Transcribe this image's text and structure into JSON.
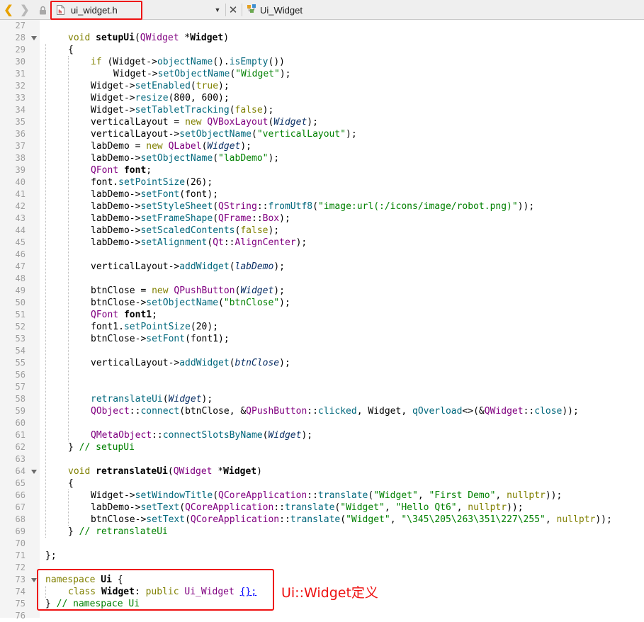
{
  "toolbar": {
    "back_icon": "chevron-left-icon",
    "forward_icon": "chevron-right-icon",
    "lock_icon": "lock-icon",
    "file_icon": "header-file-icon",
    "file_tab_label": "ui_widget.h",
    "dropdown_icon": "dropdown-arrow-icon",
    "close_icon": "close-icon",
    "class_icon": "class-icon",
    "class_selector_label": "Ui_Widget"
  },
  "editor": {
    "lines": [
      {
        "n": "27",
        "fold": false,
        "indent": 0,
        "tokens": []
      },
      {
        "n": "28",
        "fold": true,
        "indent": 1,
        "tokens": [
          [
            "kw",
            "void "
          ],
          [
            "fnb",
            "setupUi"
          ],
          [
            "p",
            "("
          ],
          [
            "type",
            "QWidget"
          ],
          [
            "p",
            " *"
          ],
          [
            "b",
            "Widget"
          ],
          [
            "p",
            ")"
          ]
        ]
      },
      {
        "n": "29",
        "fold": false,
        "indent": 1,
        "tokens": [
          [
            "p",
            "{"
          ]
        ]
      },
      {
        "n": "30",
        "fold": false,
        "indent": 2,
        "tokens": [
          [
            "kw",
            "if"
          ],
          [
            "p",
            " (Widget->"
          ],
          [
            "fn",
            "objectName"
          ],
          [
            "p",
            "()."
          ],
          [
            "fn",
            "isEmpty"
          ],
          [
            "p",
            "())"
          ]
        ]
      },
      {
        "n": "31",
        "fold": false,
        "indent": 3,
        "tokens": [
          [
            "p",
            "Widget->"
          ],
          [
            "fn",
            "setObjectName"
          ],
          [
            "p",
            "("
          ],
          [
            "str",
            "\"Widget\""
          ],
          [
            "p",
            ");"
          ]
        ]
      },
      {
        "n": "32",
        "fold": false,
        "indent": 2,
        "tokens": [
          [
            "p",
            "Widget->"
          ],
          [
            "fn",
            "setEnabled"
          ],
          [
            "p",
            "("
          ],
          [
            "kw",
            "true"
          ],
          [
            "p",
            ");"
          ]
        ]
      },
      {
        "n": "33",
        "fold": false,
        "indent": 2,
        "tokens": [
          [
            "p",
            "Widget->"
          ],
          [
            "fn",
            "resize"
          ],
          [
            "p",
            "(800, 600);"
          ]
        ]
      },
      {
        "n": "34",
        "fold": false,
        "indent": 2,
        "tokens": [
          [
            "p",
            "Widget->"
          ],
          [
            "fn",
            "setTabletTracking"
          ],
          [
            "p",
            "("
          ],
          [
            "kw",
            "false"
          ],
          [
            "p",
            ");"
          ]
        ]
      },
      {
        "n": "35",
        "fold": false,
        "indent": 2,
        "tokens": [
          [
            "p",
            "verticalLayout = "
          ],
          [
            "kw",
            "new "
          ],
          [
            "type",
            "QVBoxLayout"
          ],
          [
            "p",
            "("
          ],
          [
            "it",
            "Widget"
          ],
          [
            "p",
            ");"
          ]
        ]
      },
      {
        "n": "36",
        "fold": false,
        "indent": 2,
        "tokens": [
          [
            "p",
            "verticalLayout->"
          ],
          [
            "fn",
            "setObjectName"
          ],
          [
            "p",
            "("
          ],
          [
            "str",
            "\"verticalLayout\""
          ],
          [
            "p",
            ");"
          ]
        ]
      },
      {
        "n": "37",
        "fold": false,
        "indent": 2,
        "tokens": [
          [
            "p",
            "labDemo = "
          ],
          [
            "kw",
            "new "
          ],
          [
            "type",
            "QLabel"
          ],
          [
            "p",
            "("
          ],
          [
            "it",
            "Widget"
          ],
          [
            "p",
            ");"
          ]
        ]
      },
      {
        "n": "38",
        "fold": false,
        "indent": 2,
        "tokens": [
          [
            "p",
            "labDemo->"
          ],
          [
            "fn",
            "setObjectName"
          ],
          [
            "p",
            "("
          ],
          [
            "str",
            "\"labDemo\""
          ],
          [
            "p",
            ");"
          ]
        ]
      },
      {
        "n": "39",
        "fold": false,
        "indent": 2,
        "tokens": [
          [
            "type",
            "QFont "
          ],
          [
            "b",
            "font"
          ],
          [
            "p",
            ";"
          ]
        ]
      },
      {
        "n": "40",
        "fold": false,
        "indent": 2,
        "tokens": [
          [
            "p",
            "font."
          ],
          [
            "fn",
            "setPointSize"
          ],
          [
            "p",
            "(26);"
          ]
        ]
      },
      {
        "n": "41",
        "fold": false,
        "indent": 2,
        "tokens": [
          [
            "p",
            "labDemo->"
          ],
          [
            "fn",
            "setFont"
          ],
          [
            "p",
            "(font);"
          ]
        ]
      },
      {
        "n": "42",
        "fold": false,
        "indent": 2,
        "tokens": [
          [
            "p",
            "labDemo->"
          ],
          [
            "fn",
            "setStyleSheet"
          ],
          [
            "p",
            "("
          ],
          [
            "type",
            "QString"
          ],
          [
            "p",
            "::"
          ],
          [
            "fn",
            "fromUtf8"
          ],
          [
            "p",
            "("
          ],
          [
            "str",
            "\"image:url(:/icons/image/robot.png)\""
          ],
          [
            "p",
            "));"
          ]
        ]
      },
      {
        "n": "43",
        "fold": false,
        "indent": 2,
        "tokens": [
          [
            "p",
            "labDemo->"
          ],
          [
            "fn",
            "setFrameShape"
          ],
          [
            "p",
            "("
          ],
          [
            "type",
            "QFrame"
          ],
          [
            "p",
            "::"
          ],
          [
            "type",
            "Box"
          ],
          [
            "p",
            ");"
          ]
        ]
      },
      {
        "n": "44",
        "fold": false,
        "indent": 2,
        "tokens": [
          [
            "p",
            "labDemo->"
          ],
          [
            "fn",
            "setScaledContents"
          ],
          [
            "p",
            "("
          ],
          [
            "kw",
            "false"
          ],
          [
            "p",
            ");"
          ]
        ]
      },
      {
        "n": "45",
        "fold": false,
        "indent": 2,
        "tokens": [
          [
            "p",
            "labDemo->"
          ],
          [
            "fn",
            "setAlignment"
          ],
          [
            "p",
            "("
          ],
          [
            "type",
            "Qt"
          ],
          [
            "p",
            "::"
          ],
          [
            "type",
            "AlignCenter"
          ],
          [
            "p",
            ");"
          ]
        ]
      },
      {
        "n": "46",
        "fold": false,
        "indent": 2,
        "tokens": []
      },
      {
        "n": "47",
        "fold": false,
        "indent": 2,
        "tokens": [
          [
            "p",
            "verticalLayout->"
          ],
          [
            "fn",
            "addWidget"
          ],
          [
            "p",
            "("
          ],
          [
            "it",
            "labDemo"
          ],
          [
            "p",
            ");"
          ]
        ]
      },
      {
        "n": "48",
        "fold": false,
        "indent": 2,
        "tokens": []
      },
      {
        "n": "49",
        "fold": false,
        "indent": 2,
        "tokens": [
          [
            "p",
            "btnClose = "
          ],
          [
            "kw",
            "new "
          ],
          [
            "type",
            "QPushButton"
          ],
          [
            "p",
            "("
          ],
          [
            "it",
            "Widget"
          ],
          [
            "p",
            ");"
          ]
        ]
      },
      {
        "n": "50",
        "fold": false,
        "indent": 2,
        "tokens": [
          [
            "p",
            "btnClose->"
          ],
          [
            "fn",
            "setObjectName"
          ],
          [
            "p",
            "("
          ],
          [
            "str",
            "\"btnClose\""
          ],
          [
            "p",
            ");"
          ]
        ]
      },
      {
        "n": "51",
        "fold": false,
        "indent": 2,
        "tokens": [
          [
            "type",
            "QFont "
          ],
          [
            "b",
            "font1"
          ],
          [
            "p",
            ";"
          ]
        ]
      },
      {
        "n": "52",
        "fold": false,
        "indent": 2,
        "tokens": [
          [
            "p",
            "font1."
          ],
          [
            "fn",
            "setPointSize"
          ],
          [
            "p",
            "(20);"
          ]
        ]
      },
      {
        "n": "53",
        "fold": false,
        "indent": 2,
        "tokens": [
          [
            "p",
            "btnClose->"
          ],
          [
            "fn",
            "setFont"
          ],
          [
            "p",
            "(font1);"
          ]
        ]
      },
      {
        "n": "54",
        "fold": false,
        "indent": 2,
        "tokens": []
      },
      {
        "n": "55",
        "fold": false,
        "indent": 2,
        "tokens": [
          [
            "p",
            "verticalLayout->"
          ],
          [
            "fn",
            "addWidget"
          ],
          [
            "p",
            "("
          ],
          [
            "it",
            "btnClose"
          ],
          [
            "p",
            ");"
          ]
        ]
      },
      {
        "n": "56",
        "fold": false,
        "indent": 2,
        "tokens": []
      },
      {
        "n": "57",
        "fold": false,
        "indent": 2,
        "tokens": []
      },
      {
        "n": "58",
        "fold": false,
        "indent": 2,
        "tokens": [
          [
            "fn",
            "retranslateUi"
          ],
          [
            "p",
            "("
          ],
          [
            "it",
            "Widget"
          ],
          [
            "p",
            ");"
          ]
        ]
      },
      {
        "n": "59",
        "fold": false,
        "indent": 2,
        "tokens": [
          [
            "type",
            "QObject"
          ],
          [
            "p",
            "::"
          ],
          [
            "fn",
            "connect"
          ],
          [
            "p",
            "(btnClose, &"
          ],
          [
            "type",
            "QPushButton"
          ],
          [
            "p",
            "::"
          ],
          [
            "fn",
            "clicked"
          ],
          [
            "p",
            ", Widget, "
          ],
          [
            "fn",
            "qOverload"
          ],
          [
            "p",
            "<>(&"
          ],
          [
            "type",
            "QWidget"
          ],
          [
            "p",
            "::"
          ],
          [
            "fn",
            "close"
          ],
          [
            "p",
            "));"
          ]
        ]
      },
      {
        "n": "60",
        "fold": false,
        "indent": 2,
        "tokens": []
      },
      {
        "n": "61",
        "fold": false,
        "indent": 2,
        "tokens": [
          [
            "type",
            "QMetaObject"
          ],
          [
            "p",
            "::"
          ],
          [
            "fn",
            "connectSlotsByName"
          ],
          [
            "p",
            "("
          ],
          [
            "it",
            "Widget"
          ],
          [
            "p",
            ");"
          ]
        ]
      },
      {
        "n": "62",
        "fold": false,
        "indent": 1,
        "tokens": [
          [
            "p",
            "} "
          ],
          [
            "cmt",
            "// setupUi"
          ]
        ]
      },
      {
        "n": "63",
        "fold": false,
        "indent": 1,
        "tokens": []
      },
      {
        "n": "64",
        "fold": true,
        "indent": 1,
        "tokens": [
          [
            "kw",
            "void "
          ],
          [
            "fnb",
            "retranslateUi"
          ],
          [
            "p",
            "("
          ],
          [
            "type",
            "QWidget"
          ],
          [
            "p",
            " *"
          ],
          [
            "b",
            "Widget"
          ],
          [
            "p",
            ")"
          ]
        ]
      },
      {
        "n": "65",
        "fold": false,
        "indent": 1,
        "tokens": [
          [
            "p",
            "{"
          ]
        ]
      },
      {
        "n": "66",
        "fold": false,
        "indent": 2,
        "tokens": [
          [
            "p",
            "Widget->"
          ],
          [
            "fn",
            "setWindowTitle"
          ],
          [
            "p",
            "("
          ],
          [
            "type",
            "QCoreApplication"
          ],
          [
            "p",
            "::"
          ],
          [
            "fn",
            "translate"
          ],
          [
            "p",
            "("
          ],
          [
            "str",
            "\"Widget\""
          ],
          [
            "p",
            ", "
          ],
          [
            "str",
            "\"First Demo\""
          ],
          [
            "p",
            ", "
          ],
          [
            "kw",
            "nullptr"
          ],
          [
            "p",
            "));"
          ]
        ]
      },
      {
        "n": "67",
        "fold": false,
        "indent": 2,
        "tokens": [
          [
            "p",
            "labDemo->"
          ],
          [
            "fn",
            "setText"
          ],
          [
            "p",
            "("
          ],
          [
            "type",
            "QCoreApplication"
          ],
          [
            "p",
            "::"
          ],
          [
            "fn",
            "translate"
          ],
          [
            "p",
            "("
          ],
          [
            "str",
            "\"Widget\""
          ],
          [
            "p",
            ", "
          ],
          [
            "str",
            "\"Hello Qt6\""
          ],
          [
            "p",
            ", "
          ],
          [
            "kw",
            "nullptr"
          ],
          [
            "p",
            "));"
          ]
        ]
      },
      {
        "n": "68",
        "fold": false,
        "indent": 2,
        "tokens": [
          [
            "p",
            "btnClose->"
          ],
          [
            "fn",
            "setText"
          ],
          [
            "p",
            "("
          ],
          [
            "type",
            "QCoreApplication"
          ],
          [
            "p",
            "::"
          ],
          [
            "fn",
            "translate"
          ],
          [
            "p",
            "("
          ],
          [
            "str",
            "\"Widget\""
          ],
          [
            "p",
            ", "
          ],
          [
            "str",
            "\"\\345\\205\\263\\351\\227\\255\""
          ],
          [
            "p",
            ", "
          ],
          [
            "kw",
            "nullptr"
          ],
          [
            "p",
            "));"
          ]
        ]
      },
      {
        "n": "69",
        "fold": false,
        "indent": 1,
        "tokens": [
          [
            "p",
            "} "
          ],
          [
            "cmt",
            "// retranslateUi"
          ]
        ]
      },
      {
        "n": "70",
        "fold": false,
        "indent": 1,
        "tokens": []
      },
      {
        "n": "71",
        "fold": false,
        "indent": 0,
        "tokens": [
          [
            "p",
            "};"
          ]
        ]
      },
      {
        "n": "72",
        "fold": false,
        "indent": 0,
        "tokens": []
      },
      {
        "n": "73",
        "fold": true,
        "indent": 0,
        "tokens": [
          [
            "kw",
            "namespace "
          ],
          [
            "b",
            "Ui"
          ],
          [
            "p",
            " {"
          ]
        ]
      },
      {
        "n": "74",
        "fold": false,
        "indent": 1,
        "tokens": [
          [
            "kw",
            "class "
          ],
          [
            "b",
            "Widget"
          ],
          [
            "p",
            ": "
          ],
          [
            "kw",
            "public "
          ],
          [
            "type",
            "Ui_Widget"
          ],
          [
            "p",
            " "
          ],
          [
            "link",
            "{};"
          ]
        ]
      },
      {
        "n": "75",
        "fold": false,
        "indent": 0,
        "tokens": [
          [
            "p",
            "} "
          ],
          [
            "cmt",
            "// namespace Ui"
          ]
        ]
      },
      {
        "n": "76",
        "fold": false,
        "indent": 0,
        "tokens": []
      }
    ]
  },
  "annotation": {
    "label": "Ui::Widget定义",
    "color": "#ee1111"
  }
}
